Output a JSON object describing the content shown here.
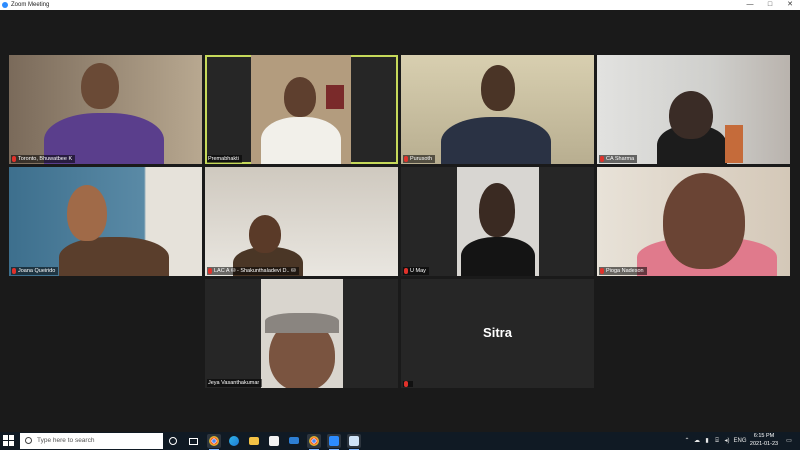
{
  "window": {
    "title": "Zoom Meeting",
    "minimize": "—",
    "maximize": "□",
    "close": "✕"
  },
  "participants": [
    {
      "name": "Toronto, Bhuwatbee K",
      "muted": true
    },
    {
      "name": "Premabhakti",
      "muted": false,
      "speaking": true
    },
    {
      "name": "Purusoth",
      "muted": true
    },
    {
      "name": "CA Sharma",
      "muted": true
    },
    {
      "name": "Joana Queirido",
      "muted": true
    },
    {
      "name": "LAC A ⛁ - Shakunthaladevi D.. ⛁",
      "muted": true
    },
    {
      "name": "U May",
      "muted": true
    },
    {
      "name": "Pioga Nadeson",
      "muted": true
    },
    {
      "name": "Jeya Vasanthakumar",
      "muted": false
    },
    {
      "name": "",
      "muted": true,
      "display_text": "Sitra"
    }
  ],
  "taskbar": {
    "search_placeholder": "Type here to search",
    "apps": [
      "cortana-icon",
      "task-view-icon",
      "chrome-icon",
      "edge-icon",
      "file-explorer-icon",
      "store-icon",
      "mail-icon",
      "chrome-icon",
      "chrome-icon",
      "zoom-icon",
      "notepad-icon"
    ],
    "language": "ENG",
    "time": "6:15 PM",
    "date": "2021-01-23"
  },
  "colors": {
    "accent": "#c6d95a",
    "muted": "#e0322b",
    "taskbar": "#101a24"
  }
}
